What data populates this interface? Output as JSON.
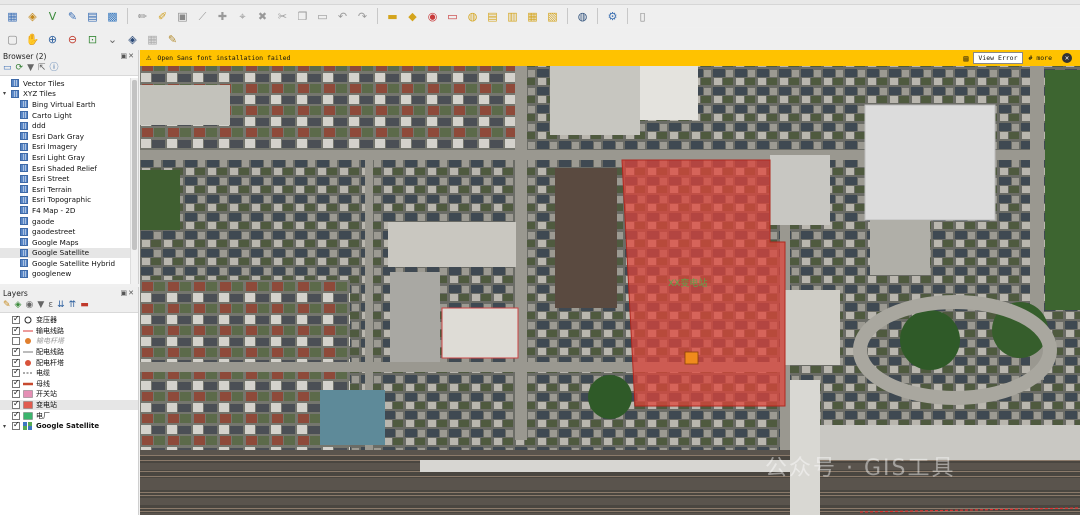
{
  "browser": {
    "title": "Browser (2)",
    "items": [
      {
        "label": "Vector Tiles",
        "kind": "root"
      },
      {
        "label": "XYZ Tiles",
        "kind": "root"
      },
      {
        "label": "Bing Virtual Earth"
      },
      {
        "label": "Carto Light"
      },
      {
        "label": "ddd"
      },
      {
        "label": "Esri Dark Gray"
      },
      {
        "label": "Esri Imagery"
      },
      {
        "label": "Esri Light Gray"
      },
      {
        "label": "Esri Shaded Relief"
      },
      {
        "label": "Esri Street"
      },
      {
        "label": "Esri Terrain"
      },
      {
        "label": "Esri Topographic"
      },
      {
        "label": "F4 Map - 2D"
      },
      {
        "label": "gaode"
      },
      {
        "label": "gaodestreet"
      },
      {
        "label": "Google Maps"
      },
      {
        "label": "Google Satellite",
        "selected": true
      },
      {
        "label": "Google Satellite Hybrid"
      },
      {
        "label": "googlenew"
      }
    ]
  },
  "layers": {
    "title": "Layers",
    "items": [
      {
        "label": "变压器",
        "checked": true,
        "symbol": "circle-outline",
        "color": "#2b2b2b"
      },
      {
        "label": "输电线路",
        "checked": true,
        "symbol": "line",
        "color": "#d83a3a"
      },
      {
        "label": "输电杆塔",
        "checked": false,
        "symbol": "circle-fill",
        "color": "#e07f2e",
        "muted": true
      },
      {
        "label": "配电线路",
        "checked": true,
        "symbol": "line",
        "color": "#7a7a7a"
      },
      {
        "label": "配电杆塔",
        "checked": true,
        "symbol": "circle-fill",
        "color": "#d9533a"
      },
      {
        "label": "电缆",
        "checked": true,
        "symbol": "dash",
        "color": "#555555"
      },
      {
        "label": "母线",
        "checked": true,
        "symbol": "thick-line",
        "color": "#c74a2f"
      },
      {
        "label": "开关站",
        "checked": true,
        "symbol": "rect",
        "color": "#e58fb5"
      },
      {
        "label": "变电站",
        "checked": true,
        "symbol": "rect",
        "color": "#e05a4e",
        "selected": true
      },
      {
        "label": "电厂",
        "checked": true,
        "symbol": "rect",
        "color": "#3bb56d"
      },
      {
        "label": "Google Satellite",
        "checked": true,
        "symbol": "raster",
        "color": "#3d77c2",
        "bold": true
      }
    ]
  },
  "message": {
    "text": "Open Sans font installation failed",
    "view_error": "View Error",
    "more": "# more"
  },
  "map": {
    "feature_label": "XX变电站",
    "watermark": "公众号 · GIS工具"
  },
  "colors": {
    "substation_fill": "#e0443a",
    "message_bar": "#ffc200"
  }
}
